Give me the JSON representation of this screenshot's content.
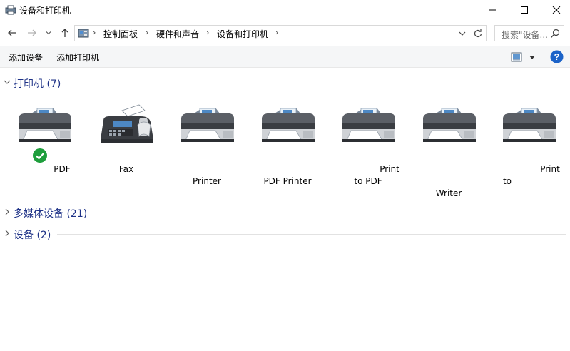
{
  "window": {
    "title": "设备和打印机",
    "controls": {
      "minimize": "minimize",
      "maximize": "maximize",
      "close": "close"
    }
  },
  "nav": {
    "breadcrumbs": [
      "控制面板",
      "硬件和声音",
      "设备和打印机"
    ],
    "search_placeholder": "搜索\"设备...",
    "icons": [
      "back-arrow-icon",
      "forward-arrow-icon",
      "recent-chevron-icon",
      "up-arrow-icon",
      "control-panel-icon",
      "dropdown-icon",
      "refresh-icon",
      "search-icon"
    ]
  },
  "commands": {
    "add_device": "添加设备",
    "add_printer": "添加打印机",
    "icons": [
      "change-view-icon",
      "view-dropdown-icon",
      "help-icon"
    ]
  },
  "groups": {
    "printers": {
      "title": "打印机 (7)",
      "expanded": true,
      "devices": [
        {
          "line1": "PDF",
          "line2": "",
          "line3": "",
          "icon": "printer-icon",
          "default": true
        },
        {
          "line1": "Fax",
          "line2": "",
          "line3": "",
          "icon": "fax-icon",
          "default": false
        },
        {
          "line1": "",
          "line2": "Printer",
          "line3": "",
          "icon": "printer-icon",
          "default": false
        },
        {
          "line1": "",
          "line2": "PDF Printer",
          "line3": "",
          "icon": "printer-icon",
          "default": false
        },
        {
          "line1": "Print",
          "line2": "to PDF",
          "line3": "",
          "icon": "printer-icon",
          "default": false
        },
        {
          "line1": "",
          "line2": "",
          "line3": "Writer",
          "icon": "printer-icon",
          "default": false
        },
        {
          "line1": "Print",
          "line2": "to",
          "line3": "",
          "icon": "printer-icon",
          "default": false
        }
      ]
    },
    "multimedia": {
      "title": "多媒体设备 (21)",
      "expanded": false
    },
    "devices": {
      "title": "设备 (2)",
      "expanded": false
    }
  },
  "colors": {
    "group_title": "#1e3287",
    "help_blue": "#1c63c8",
    "default_badge": "#1e9e3c"
  }
}
